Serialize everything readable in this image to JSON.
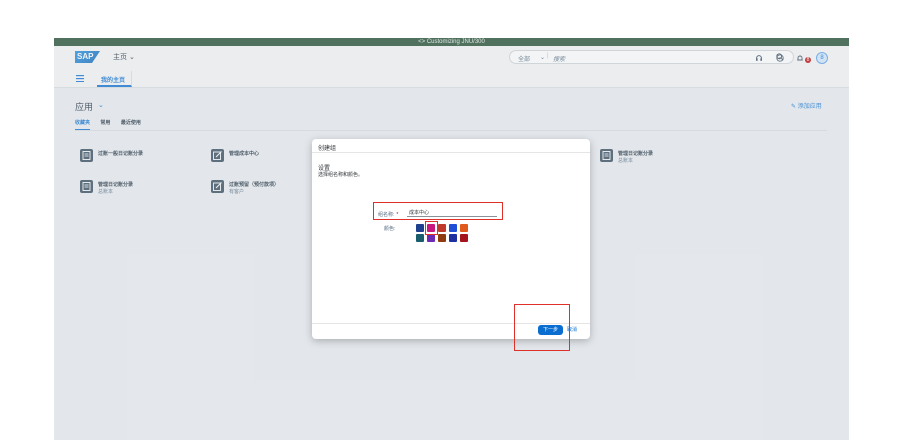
{
  "titlebar": {
    "text": "<> Customizing JNU/300"
  },
  "shellbar": {
    "logo": "SAP",
    "home_menu": "主页 ⌄",
    "search": {
      "scope": "全部",
      "scope_chevron": "⌄",
      "separator": "|",
      "placeholder": "搜索"
    },
    "notification_count": "8",
    "avatar_initial": "8",
    "icons": [
      "search-icon",
      "headset-icon",
      "help-icon",
      "bell-icon"
    ]
  },
  "navbar": {
    "my_page_tab": "我的主页"
  },
  "apps": {
    "title": "应用",
    "title_chevron": "⌄",
    "add_link": "添加应用",
    "subtabs": [
      "收藏夹",
      "常用",
      "最近使用"
    ],
    "tiles": [
      {
        "name": "过账一般日记账分录",
        "sub": ""
      },
      {
        "name": "管理成本中心",
        "sub": ""
      },
      {
        "name": "管理日记账分录",
        "sub": "总账本"
      },
      {
        "name": "管理日记账分录",
        "sub": "总账本"
      },
      {
        "name": "过账预留（预付款项）",
        "sub": "有客户"
      }
    ]
  },
  "dialog": {
    "header": "创建组",
    "section_title": "设置",
    "description": "选择组名称和颜色。",
    "name_label": "组名称:",
    "required_mark": "*",
    "name_value": "成本中心",
    "color_label": "颜色:",
    "colors": [
      "#1f3f8f",
      "#c8177f",
      "#c0392b",
      "#1f4fd6",
      "#e05a1e",
      "#1a5d6d",
      "#6b2bb5",
      "#8e3b10",
      "#1f2f9f",
      "#a3141e"
    ],
    "next_button": "下一步",
    "cancel_button": "取消"
  }
}
